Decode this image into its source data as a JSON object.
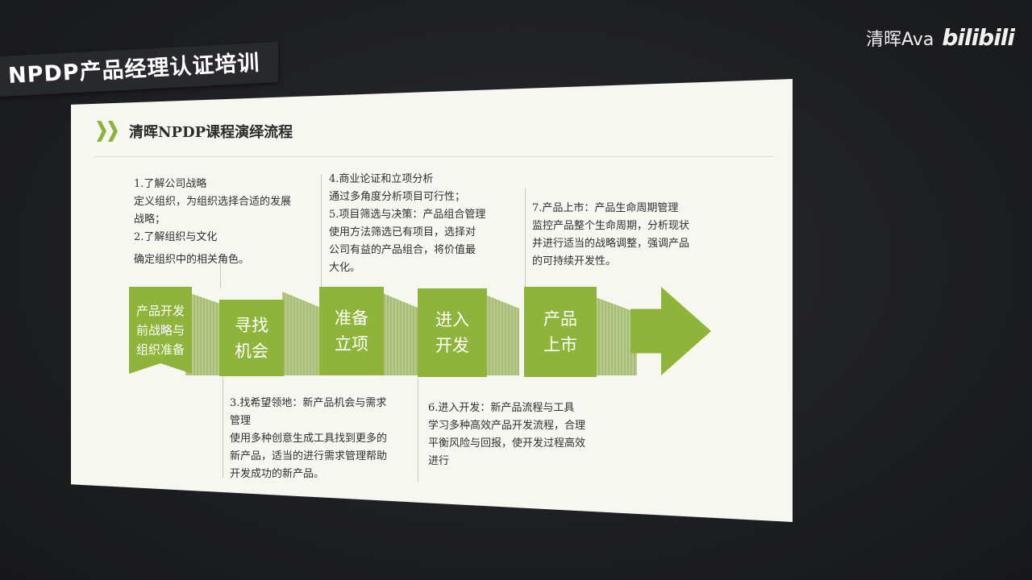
{
  "banner": {
    "title": "NPDP产品经理认证培训"
  },
  "watermark": {
    "author": "清晖Ava",
    "logo": "bilibili"
  },
  "slide": {
    "title": "清晖NPDP课程演绎流程",
    "notes": {
      "top_left": [
        "1.了解公司战略",
        "定义组织，为组织选择合适的发展",
        "战略；",
        "2.了解组织与文化",
        "确定组织中的相关角色。"
      ],
      "top_middle": [
        "4.商业论证和立项分析",
        "通过多角度分析项目可行性；",
        "5.项目筛选与决策：产品组合管理",
        "使用方法筛选已有项目，选择对",
        "公司有益的产品组合，将价值最",
        "大化。"
      ],
      "top_right": [
        "7.产品上市：产品生命周期管理",
        "监控产品整个生命周期，分析现状",
        "并进行适当的战略调整，强调产品",
        "的可持续开发性。"
      ],
      "bottom_left": [
        "3.找希望领地：新产品机会与需求",
        "管理",
        "使用多种创意生成工具找到更多的",
        "新产品，适当的进行需求管理帮助",
        "开发成功的新产品。"
      ],
      "bottom_middle": [
        "6.进入开发：新产品流程与工具",
        "学习多种高效产品开发流程，合理",
        "平衡风险与回报，使开发过程高效",
        "进行"
      ]
    },
    "steps": [
      {
        "label": "产品开发\n前战略与\n组织准备"
      },
      {
        "label": "寻找\n机会"
      },
      {
        "label": "准备\n立项"
      },
      {
        "label": "进入\n开发"
      },
      {
        "label": "产品\n上市"
      }
    ],
    "colors": {
      "accent": "#8fb43c",
      "shadow": "#b8c98d"
    }
  }
}
